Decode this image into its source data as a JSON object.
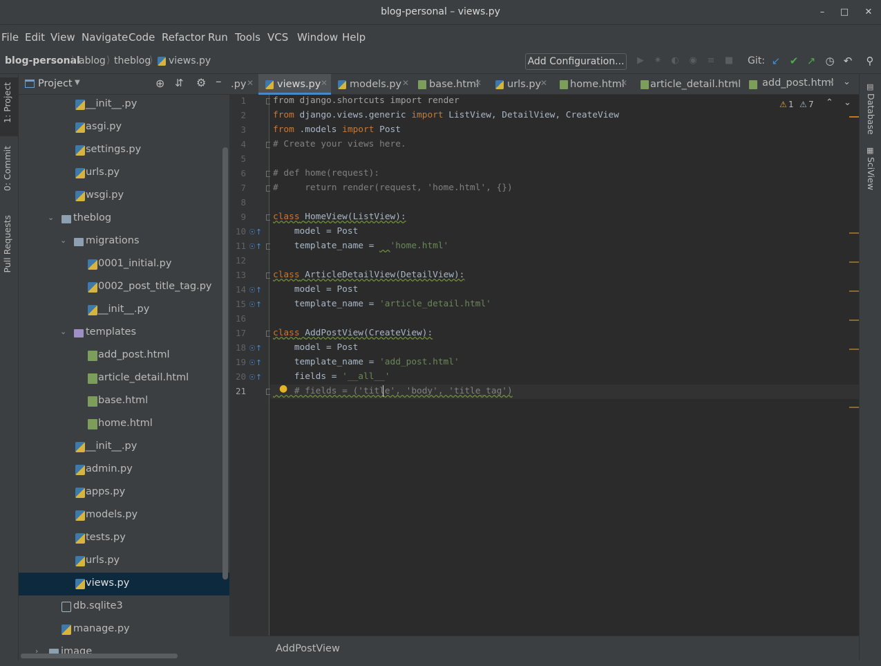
{
  "window": {
    "title": "blog-personal – views.py"
  },
  "menu": [
    "File",
    "Edit",
    "View",
    "Navigate",
    "Code",
    "Refactor",
    "Run",
    "Tools",
    "VCS",
    "Window",
    "Help"
  ],
  "breadcrumbs": [
    "blog-personal",
    "ablog",
    "theblog",
    "views.py"
  ],
  "toolbar": {
    "add_config": "Add Configuration...",
    "git_label": "Git:"
  },
  "left_tabs": [
    "1: Project",
    "0: Commit",
    "Pull Requests"
  ],
  "right_tabs": [
    "Database",
    "SciView"
  ],
  "project": {
    "title": "Project",
    "tree": [
      {
        "label": "__init__.py",
        "type": "py"
      },
      {
        "label": "asgi.py",
        "type": "py"
      },
      {
        "label": "settings.py",
        "type": "py"
      },
      {
        "label": "urls.py",
        "type": "py"
      },
      {
        "label": "wsgi.py",
        "type": "py"
      },
      {
        "label": "theblog",
        "type": "folder"
      },
      {
        "label": "migrations",
        "type": "folder"
      },
      {
        "label": "0001_initial.py",
        "type": "py"
      },
      {
        "label": "0002_post_title_tag.py",
        "type": "py"
      },
      {
        "label": "__init__.py",
        "type": "py"
      },
      {
        "label": "templates",
        "type": "folder-purple"
      },
      {
        "label": "add_post.html",
        "type": "html"
      },
      {
        "label": "article_detail.html",
        "type": "html"
      },
      {
        "label": "base.html",
        "type": "html"
      },
      {
        "label": "home.html",
        "type": "html"
      },
      {
        "label": "__init__.py",
        "type": "py"
      },
      {
        "label": "admin.py",
        "type": "py"
      },
      {
        "label": "apps.py",
        "type": "py"
      },
      {
        "label": "models.py",
        "type": "py"
      },
      {
        "label": "tests.py",
        "type": "py"
      },
      {
        "label": "urls.py",
        "type": "py"
      },
      {
        "label": "views.py",
        "type": "py"
      },
      {
        "label": "db.sqlite3",
        "type": "db"
      },
      {
        "label": "manage.py",
        "type": "py"
      },
      {
        "label": "image",
        "type": "folder"
      }
    ]
  },
  "tabs": [
    ".py",
    "views.py",
    "models.py",
    "base.html",
    "urls.py",
    "home.html",
    "article_detail.html",
    "add_post.html"
  ],
  "inspections": {
    "errors": "1",
    "warnings": "7"
  },
  "code": {
    "line_numbers": [
      "1",
      "2",
      "3",
      "4",
      "5",
      "6",
      "7",
      "8",
      "9",
      "10",
      "11",
      "12",
      "13",
      "14",
      "15",
      "16",
      "17",
      "18",
      "19",
      "20",
      "21"
    ],
    "l1": [
      "from",
      " django.shortcuts ",
      "import",
      " render"
    ],
    "l2": [
      "from",
      " django.views.generic ",
      "import",
      " ListView, DetailView, CreateView"
    ],
    "l3": [
      "from",
      " .models ",
      "import",
      " Post"
    ],
    "l4": "# Create your views here.",
    "l6": "# def home(request):",
    "l7": "#     return render(request, 'home.html', {})",
    "l9": [
      "class",
      " ",
      "HomeView(ListView):"
    ],
    "l10": "    model = Post",
    "l11": [
      "    template_name = ",
      "  ",
      "'home.html'"
    ],
    "l13": [
      "class",
      " ",
      "ArticleDetailView(DetailView):"
    ],
    "l14": "    model = Post",
    "l15": [
      "    template_name = ",
      "'article_detail.html'"
    ],
    "l17": [
      "class",
      " ",
      "AddPostView(CreateView):"
    ],
    "l18": "    model = Post",
    "l19": [
      "    template_name = ",
      "'add_post.html'"
    ],
    "l20": [
      "    fields = ",
      "'__all__'"
    ],
    "l21": "    # fields = ('title', 'body', 'title_tag')"
  },
  "status": {
    "breadcrumb": "AddPostView"
  }
}
